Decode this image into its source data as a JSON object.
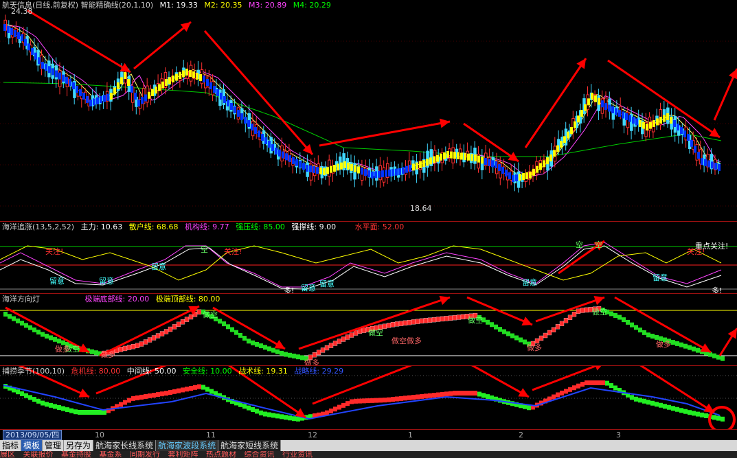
{
  "main_pane": {
    "title": "航天信息(日线,前复权) 智能精确线(20,1,10)",
    "ma_labels": [
      {
        "text": "M1: 19.33",
        "color": "#ffffff"
      },
      {
        "text": "M2: 20.35",
        "color": "#ffff00"
      },
      {
        "text": "M3: 20.89",
        "color": "#ff44ff"
      },
      {
        "text": "M4: 20.29",
        "color": "#00ff00"
      }
    ],
    "high_label": "24.38",
    "low_label": "18.64"
  },
  "pane2": {
    "title": "海洋追涨(13,5,2,52)",
    "values": [
      {
        "text": "主力: 10.63",
        "color": "#ffffff"
      },
      {
        "text": "散户线: 68.68",
        "color": "#ffff00"
      },
      {
        "text": "机构线: 9.77",
        "color": "#ff44ff"
      },
      {
        "text": "强压线: 85.00",
        "color": "#00ff00"
      },
      {
        "text": "强撑线: 9.00",
        "color": "#ffffff"
      },
      {
        "text": "水平面: 52.00",
        "color": "#ff2a2a"
      }
    ],
    "annotations": {
      "guanzhu": "关注!",
      "liuyi": "留意",
      "kong": "空",
      "duo": "多!",
      "focus": "重点关注!"
    }
  },
  "pane3": {
    "title": "海洋方向灯",
    "values": [
      {
        "text": "极端底部线: 20.00",
        "color": "#ff44ff"
      },
      {
        "text": "极端顶部线: 80.00",
        "color": "#ffff00"
      }
    ],
    "annotations": {
      "zuokong": "做空",
      "zuoduo": "做多",
      "zuokong_zuoduo": "做空做多"
    }
  },
  "pane4": {
    "title": "捕捞季节(100,10)",
    "values": [
      {
        "text": "危机线: 80.00",
        "color": "#ff2a2a"
      },
      {
        "text": "中间线: 50.00",
        "color": "#ffffff"
      },
      {
        "text": "安全线: 10.00",
        "color": "#00ff00"
      },
      {
        "text": "战术线: 19.31",
        "color": "#ffff00"
      },
      {
        "text": "战略线: 29.29",
        "color": "#3355ff"
      }
    ]
  },
  "time_axis": {
    "current": "2013/09/05/四",
    "ticks": [
      "10",
      "11",
      "12",
      "1",
      "2",
      "3"
    ]
  },
  "tabs": [
    "指标",
    "模板",
    "管理",
    "另存为"
  ],
  "active_tab": "模板",
  "systems": [
    "航海家长线系统",
    "航海家波段系统",
    "航海家短线系统"
  ],
  "active_system": "航海家波段系统",
  "bottom_links": [
    "展区",
    "关联报价",
    "基金持股",
    "基金系",
    "同期发行",
    "套利矩阵",
    "热点题材",
    "综合资讯",
    "行业资讯"
  ],
  "colors": {
    "up_candle": "#ff3030",
    "down_candle": "#40d8ff",
    "trend_up": "#ffff00",
    "trend_down": "#0033ff",
    "arrow": "#ff0000"
  }
}
